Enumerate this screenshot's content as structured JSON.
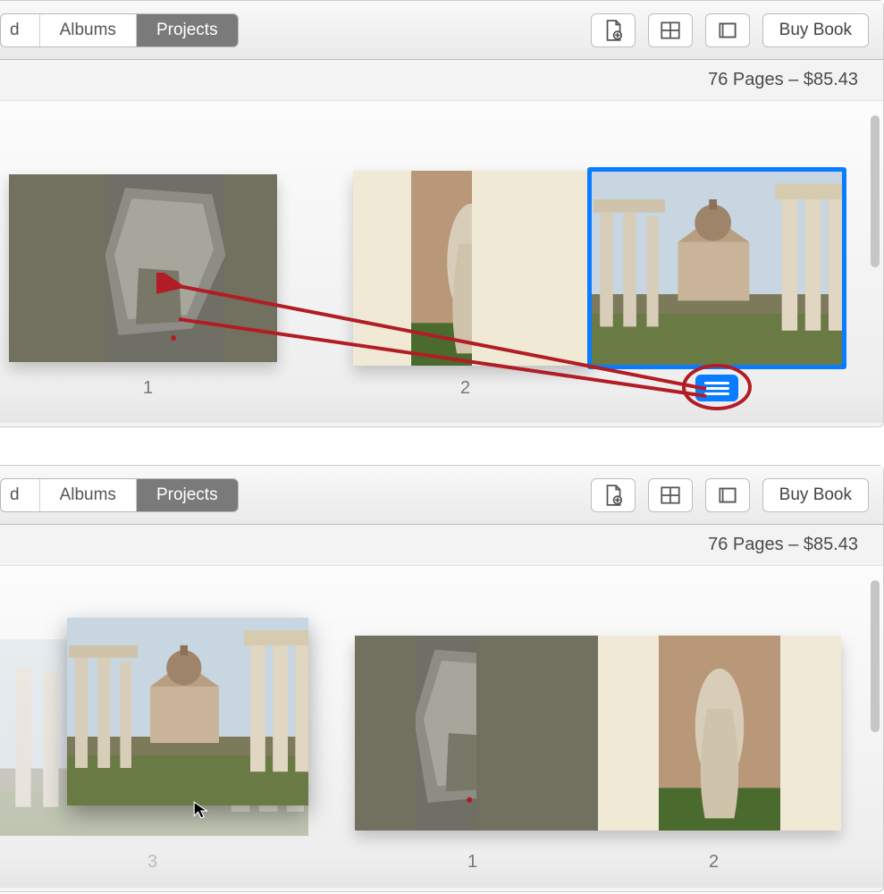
{
  "top": {
    "tabs": {
      "partial": "d",
      "albums": "Albums",
      "projects": "Projects"
    },
    "buy_label": "Buy Book",
    "info": "76 Pages – $85.43",
    "pages": {
      "p1": "1",
      "p2": "2"
    }
  },
  "bottom": {
    "tabs": {
      "partial": "d",
      "albums": "Albums",
      "projects": "Projects"
    },
    "buy_label": "Buy Book",
    "info": "76 Pages – $85.43",
    "pages": {
      "p3": "3",
      "p1": "1",
      "p2": "2"
    }
  },
  "icons": {
    "add_page": "add-page-icon",
    "layout": "layout-grid-icon",
    "book_settings": "book-settings-icon",
    "caption": "caption-lines-icon"
  },
  "annotations": {
    "arrow_color": "#b21c24",
    "ellipse_color": "#b21c24"
  }
}
